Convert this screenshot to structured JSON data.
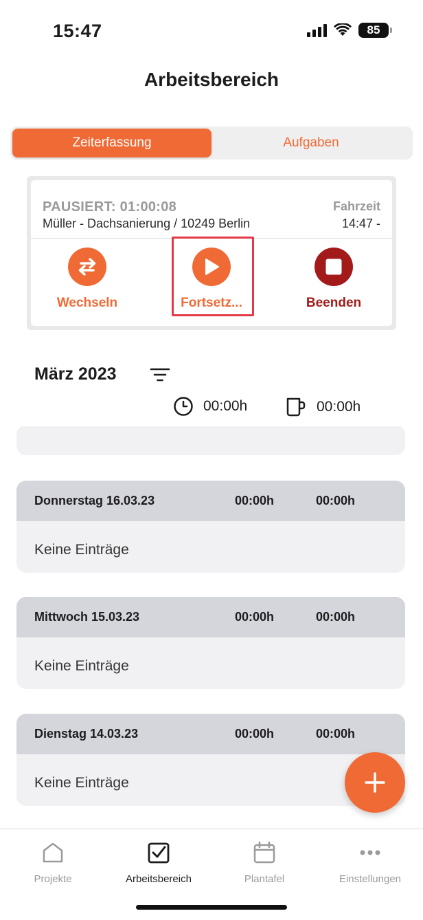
{
  "status_bar": {
    "time": "15:47",
    "battery": "85"
  },
  "header": {
    "title": "Arbeitsbereich"
  },
  "segments": [
    {
      "label": "Zeiterfassung",
      "active": true
    },
    {
      "label": "Aufgaben",
      "active": false
    }
  ],
  "timer": {
    "status": "PAUSIERT: 01:00:08",
    "project": "Müller - Dachsanierung / 10249 Berlin",
    "type": "Fahrzeit",
    "start": "14:47 -",
    "actions": {
      "switch": "Wechseln",
      "resume": "Fortsetz...",
      "stop": "Beenden"
    }
  },
  "summary": {
    "month": "März 2023",
    "work_total": "00:00h",
    "break_total": "00:00h"
  },
  "days": [
    {
      "date": "Donnerstag 16.03.23",
      "work": "00:00h",
      "break": "00:00h",
      "empty_text": "Keine Einträge"
    },
    {
      "date": "Mittwoch 15.03.23",
      "work": "00:00h",
      "break": "00:00h",
      "empty_text": "Keine Einträge"
    },
    {
      "date": "Dienstag 14.03.23",
      "work": "00:00h",
      "break": "00:00h",
      "empty_text": "Keine Einträge"
    }
  ],
  "tabbar": {
    "items": [
      {
        "label": "Projekte",
        "icon": "home-icon",
        "active": false
      },
      {
        "label": "Arbeitsbereich",
        "icon": "checkbox-icon",
        "active": true
      },
      {
        "label": "Plantafel",
        "icon": "calendar-icon",
        "active": false
      },
      {
        "label": "Einstellungen",
        "icon": "more-icon",
        "active": false
      }
    ]
  },
  "colors": {
    "accent": "#ef6a35",
    "stop": "#a31a1a",
    "highlight": "#e23a48",
    "card_bg": "#f1f1f3",
    "card_header": "#d5d6db"
  }
}
